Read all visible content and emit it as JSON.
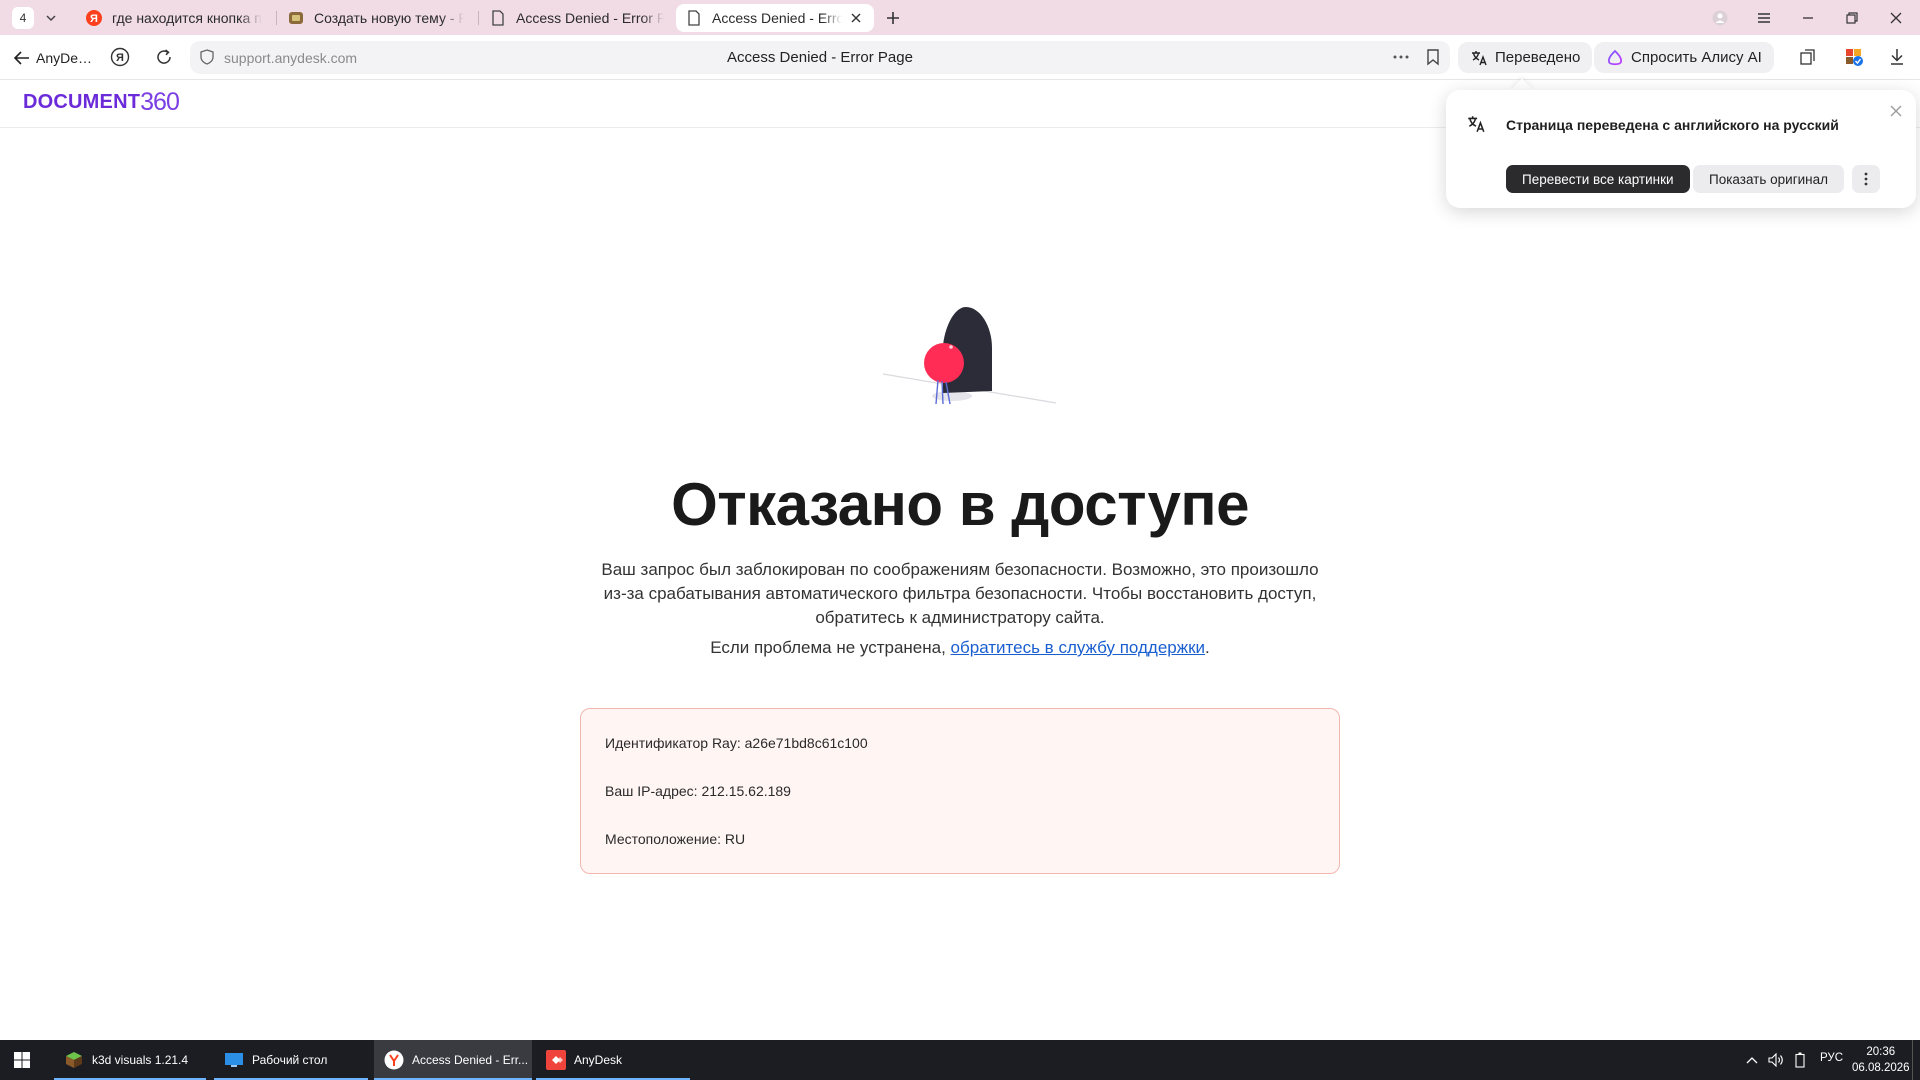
{
  "browser": {
    "tab_count": "4",
    "tabs": [
      {
        "title": "где находится кнопка при",
        "icon": "yandex-icon"
      },
      {
        "title": "Создать новую тему - Real",
        "icon": "forum-icon"
      },
      {
        "title": "Access Denied - Error Page",
        "icon": "page-icon"
      },
      {
        "title": "Access Denied - Error P",
        "icon": "page-icon",
        "active": true
      }
    ],
    "back_label": "AnyDe…",
    "url": "support.anydesk.com",
    "page_title": "Access Denied - Error Page",
    "translated_label": "Переведено",
    "alice_label": "Спросить Алису AI"
  },
  "translate_popup": {
    "message": "Страница переведена с английского на русский",
    "translate_images_label": "Перевести все картинки",
    "show_original_label": "Показать оригинал"
  },
  "site": {
    "logo_text": "DOCUMENT",
    "logo_number": "360"
  },
  "main": {
    "heading": "Отказано в доступе",
    "description": "Ваш запрос был заблокирован по соображениям безопасности. Возможно, это произошло из-за срабатывания автоматического фильтра безопасности. Чтобы восстановить доступ, обратитесь к администратору сайта.",
    "support_prefix": "Если проблема не устранена, ",
    "support_link": "обратитесь в службу поддержки",
    "support_suffix": ".",
    "info": {
      "ray_id": "Идентификатор Ray: a26e71bd8c61c100",
      "ip": "Ваш IP-адрес: 212.15.62.189",
      "location": "Местоположение: RU"
    }
  },
  "taskbar": {
    "items": [
      {
        "label": "k3d visuals 1.21.4",
        "icon": "minecraft-icon"
      },
      {
        "label": "Рабочий стол",
        "icon": "desktop-icon"
      },
      {
        "label": "Access Denied - Err...",
        "icon": "yandex-browser-icon",
        "active": true
      },
      {
        "label": "AnyDesk",
        "icon": "anydesk-icon"
      }
    ],
    "language": "РУС",
    "time": "20:36",
    "date": "06.08.2026"
  },
  "colors": {
    "tabbar": "#f1dce6",
    "accent_purple": "#6c2bd9",
    "link": "#1a5fd0",
    "info_border": "#f2b8b0",
    "info_bg": "#fff6f4",
    "taskbar": "#1c1d22"
  }
}
